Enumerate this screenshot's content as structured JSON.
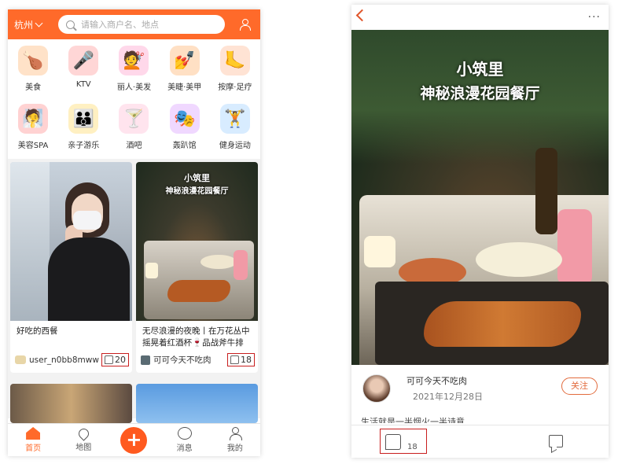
{
  "left": {
    "city": "杭州",
    "search_placeholder": "请输入商户名、地点",
    "categories": [
      {
        "label": "美食",
        "icon": "turkey-icon",
        "glyph": "🍗",
        "color": "#ffe2c8"
      },
      {
        "label": "KTV",
        "icon": "microphone-icon",
        "glyph": "🎤",
        "color": "#ffd6d6"
      },
      {
        "label": "丽人·美发",
        "icon": "hair-icon",
        "glyph": "💇",
        "color": "#ffd8ea"
      },
      {
        "label": "美睫·美甲",
        "icon": "nail-icon",
        "glyph": "💅",
        "color": "#ffe0c4"
      },
      {
        "label": "按摩·足疗",
        "icon": "foot-icon",
        "glyph": "🦶",
        "color": "#ffe3d4"
      },
      {
        "label": "美容SPA",
        "icon": "face-mask-icon",
        "glyph": "🧖",
        "color": "#ffd2d2"
      },
      {
        "label": "亲子游乐",
        "icon": "family-icon",
        "glyph": "👪",
        "color": "#fff0c2"
      },
      {
        "label": "酒吧",
        "icon": "cocktail-icon",
        "glyph": "🍸",
        "color": "#ffe4ee"
      },
      {
        "label": "轰趴馆",
        "icon": "party-mask-icon",
        "glyph": "🎭",
        "color": "#f0d8ff"
      },
      {
        "label": "健身运动",
        "icon": "dumbbell-icon",
        "glyph": "🏋",
        "color": "#d8ecff"
      }
    ],
    "cards": [
      {
        "title": "好吃的西餐",
        "user": "user_n0bb8mww",
        "likes": "20"
      },
      {
        "title": "无尽浪漫的夜晚丨在万花丛中摇晃着红酒杯🍷品战斧牛排",
        "user": "可可今天不吃肉",
        "likes": "18",
        "overlay1": "小筑里",
        "overlay2": "神秘浪漫花园餐厅"
      }
    ],
    "tabs": [
      {
        "label": "首页",
        "icon": "home-icon"
      },
      {
        "label": "地图",
        "icon": "map-pin-icon"
      },
      {
        "label": "",
        "icon": "plus-icon"
      },
      {
        "label": "消息",
        "icon": "message-icon"
      },
      {
        "label": "我的",
        "icon": "profile-icon"
      }
    ],
    "accent": "#ff6a2a"
  },
  "right": {
    "hero_line1": "小筑里",
    "hero_line2": "神秘浪漫花园餐厅",
    "more": "···",
    "author": "可可今天不吃肉",
    "date": "2021年12月28日",
    "follow": "关注",
    "caption": "生活就是一半烟火一半诗意",
    "likes": "18"
  }
}
